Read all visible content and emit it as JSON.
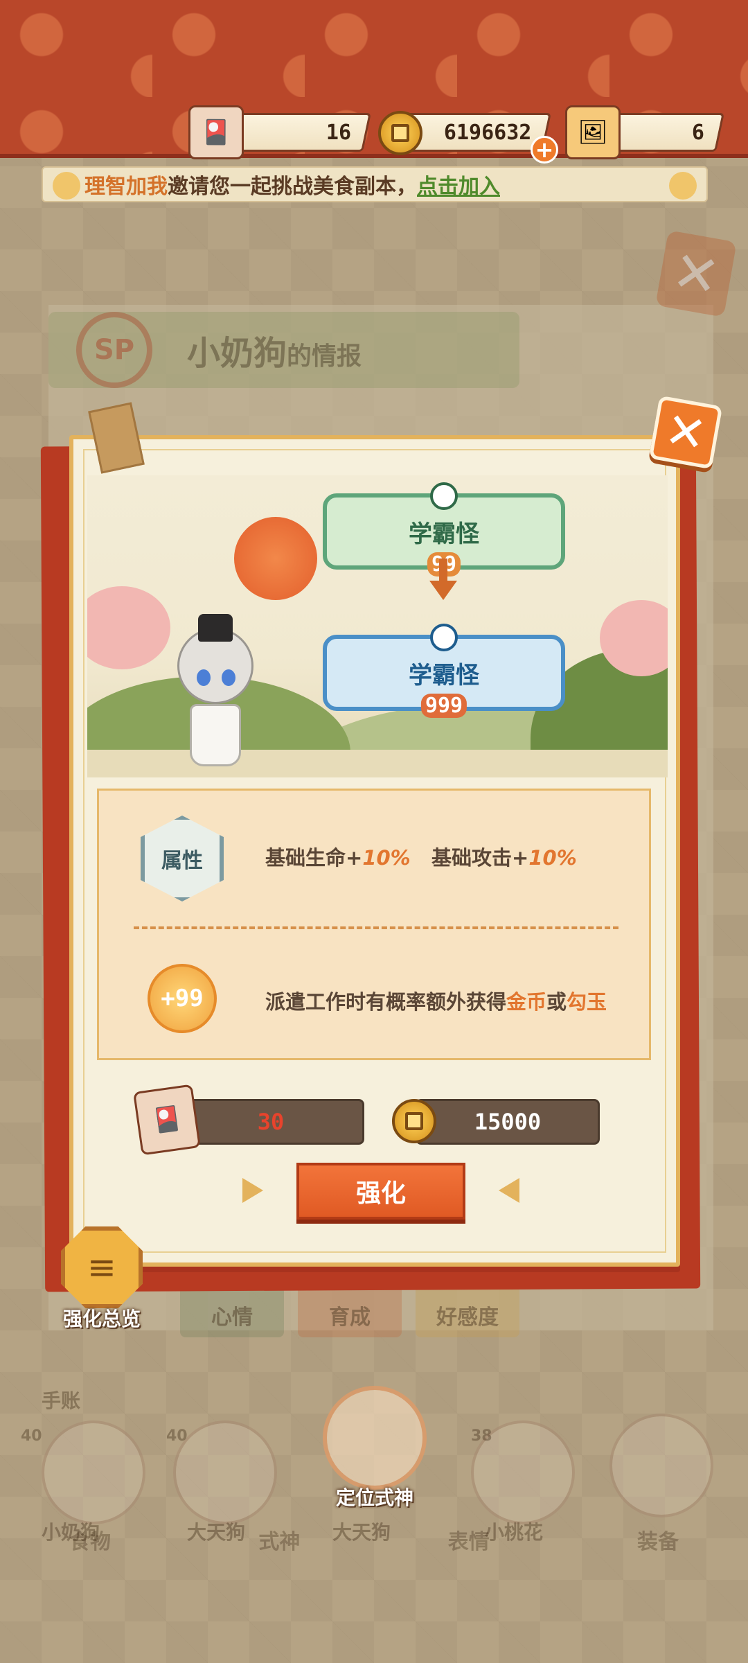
{
  "resources": {
    "tickets": "16",
    "coins": "6196632",
    "jade": "6"
  },
  "banner": {
    "inviter": "理智加我",
    "message": "邀请您一起挑战美食副本，",
    "join_label": "点击加入"
  },
  "background": {
    "sp_label": "SP",
    "title_name": "小奶狗",
    "title_suffix": "的情报",
    "tabs": [
      "心情",
      "育成",
      "好感度"
    ],
    "bottom_labels": [
      "小奶狗",
      "大天狗",
      "大天狗",
      "小桃花"
    ],
    "nav": [
      "食物",
      "式神",
      "表情",
      "装备"
    ],
    "slot_levels": [
      "40",
      "40",
      "38"
    ],
    "side_label": "手账"
  },
  "modal": {
    "from_title": "学霸怪",
    "from_level": "99",
    "to_title": "学霸怪",
    "to_level": "999",
    "attr_badge": "属性",
    "attr_line_1": "基础生命+",
    "attr_pct_1": "10%",
    "attr_line_2": "基础攻击+",
    "attr_pct_2": "10%",
    "skill_icon": "+99",
    "desc_pre": "派遣工作时有概率额外获得",
    "desc_hl1": "金币",
    "desc_mid": "或",
    "desc_hl2": "勾玉",
    "cost_tickets": "30",
    "cost_coins": "15000",
    "enhance_label": "强化",
    "close_icon": "✕"
  },
  "overview_label": "强化总览",
  "locate_label": "定位式神",
  "colors": {
    "accent_orange": "#e2762f",
    "header_red": "#b9472a",
    "join_green": "#4f8a2b"
  }
}
